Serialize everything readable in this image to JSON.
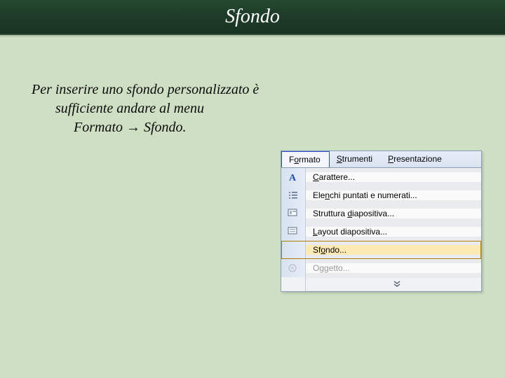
{
  "header": {
    "title": "Sfondo"
  },
  "body": {
    "line1": "Per inserire uno sfondo personalizzato è",
    "line2": "sufficiente andare al menu",
    "line3_part1": "Formato ",
    "line3_arrow": "→",
    "line3_part2": " Sfondo."
  },
  "menubar": {
    "formato": {
      "accel": "o",
      "pre": "F",
      "post": "rmato"
    },
    "strumenti": {
      "accel": "S",
      "post": "trumenti"
    },
    "presentazione": {
      "accel": "P",
      "post": "resentazione"
    }
  },
  "dropdown": {
    "carattere": {
      "accel": "C",
      "post": "arattere..."
    },
    "elenchi": {
      "pre": "Ele",
      "accel": "n",
      "post": "chi puntati e numerati..."
    },
    "struttura": {
      "pre": "Struttura ",
      "accel": "d",
      "post": "iapositiva..."
    },
    "layout": {
      "accel": "L",
      "post": "ayout diapositiva..."
    },
    "sfondo": {
      "pre": "Sf",
      "accel": "o",
      "post": "ndo..."
    },
    "oggetto": {
      "pre": "O",
      "accel": "g",
      "post": "getto..."
    }
  }
}
